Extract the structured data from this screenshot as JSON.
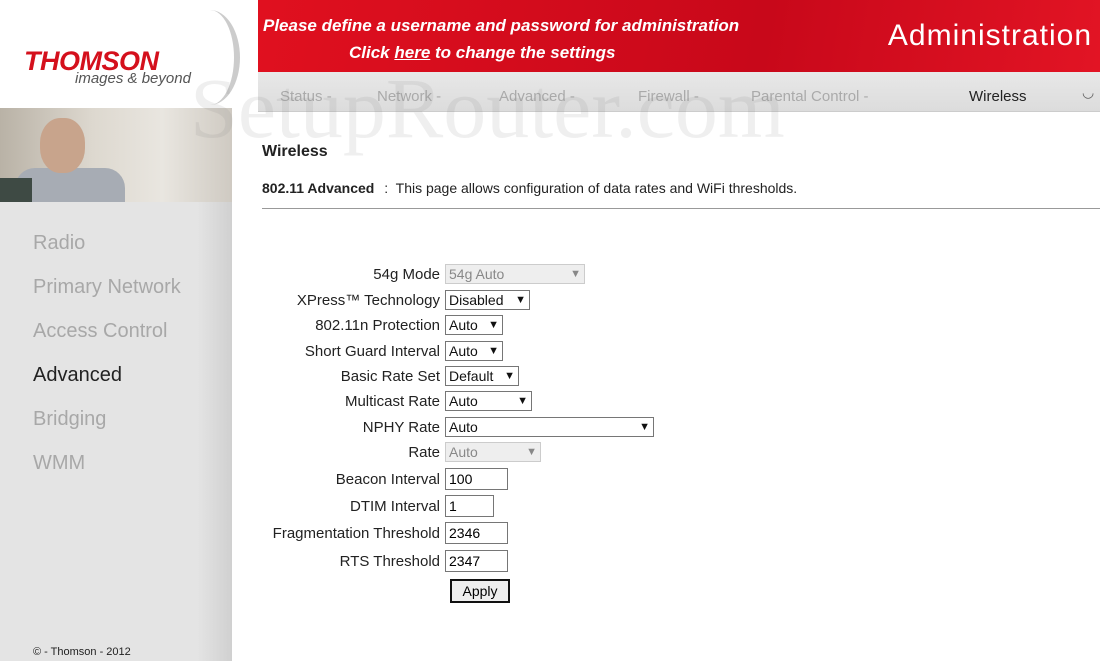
{
  "logo": {
    "brand": "THOMSON",
    "tagline": "images & beyond"
  },
  "banner": {
    "line1": "Please define a username and password for administration",
    "line2_pre": "Click ",
    "line2_link": "here",
    "line2_post": " to change the settings",
    "title": "Administration"
  },
  "nav": {
    "items": [
      "Status -",
      "Network -",
      "Advanced -",
      "Firewall -",
      "Parental Control -",
      "Wireless"
    ],
    "active": "Wireless"
  },
  "watermark": "SetupRouter.com",
  "sidebar": {
    "items": [
      "Radio",
      "Primary Network",
      "Access Control",
      "Advanced",
      "Bridging",
      "WMM"
    ],
    "active": "Advanced",
    "footer": "© - Thomson - 2012"
  },
  "page": {
    "title": "Wireless",
    "subtitle": "802.11 Advanced",
    "separator": ":",
    "description": "This page allows configuration of data rates and WiFi thresholds."
  },
  "form": {
    "mode54g": {
      "label": "54g Mode",
      "value": "54g Auto",
      "disabled": true
    },
    "xpress": {
      "label": "XPress™ Technology",
      "value": "Disabled"
    },
    "protection": {
      "label": "802.11n Protection",
      "value": "Auto"
    },
    "sgi": {
      "label": "Short Guard Interval",
      "value": "Auto"
    },
    "basic_rate": {
      "label": "Basic Rate Set",
      "value": "Default"
    },
    "multicast": {
      "label": "Multicast Rate",
      "value": "Auto"
    },
    "nphy": {
      "label": "NPHY Rate",
      "value": "Auto"
    },
    "rate": {
      "label": "Rate",
      "value": "Auto",
      "disabled": true
    },
    "beacon": {
      "label": "Beacon Interval",
      "value": "100"
    },
    "dtim": {
      "label": "DTIM Interval",
      "value": "1"
    },
    "frag": {
      "label": "Fragmentation Threshold",
      "value": "2346"
    },
    "rts": {
      "label": "RTS Threshold",
      "value": "2347"
    },
    "apply": "Apply"
  },
  "colors": {
    "brand_red": "#d4101c",
    "sidebar_bg": "#e4e4e4"
  }
}
